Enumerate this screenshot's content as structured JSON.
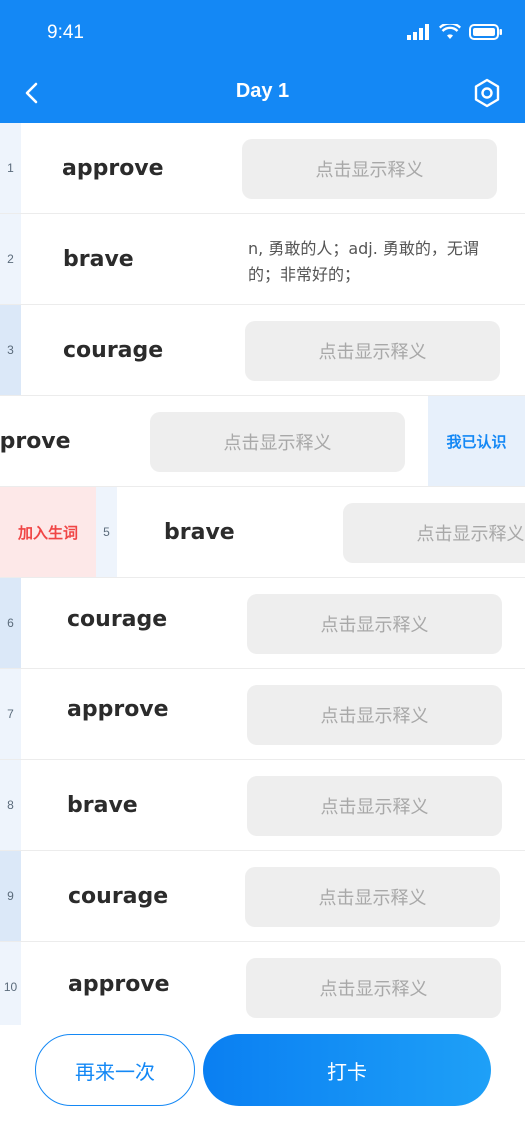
{
  "status_bar": {
    "time": "9:41"
  },
  "header": {
    "title": "Day 1",
    "back_icon": "chevron-left-icon",
    "settings_icon": "hexagon-gear-icon"
  },
  "colors": {
    "primary": "#1488f5",
    "danger": "#f04545"
  },
  "rows": [
    {
      "index": "1",
      "word": "approve",
      "meaning_button": "点击显示释义"
    },
    {
      "index": "2",
      "word": "brave",
      "meaning": "n, 勇敢的人；adj. 勇敢的，无谓的；非常好的；"
    },
    {
      "index": "3",
      "word": "courage",
      "meaning_button": "点击显示释义"
    },
    {
      "word": "approve",
      "meaning_button": "点击显示释义",
      "action": "我已认识"
    },
    {
      "index": "5",
      "word": "brave",
      "meaning_button": "点击显示释义",
      "action": "加入生词"
    },
    {
      "index": "6",
      "word": "courage",
      "meaning_button": "点击显示释义"
    },
    {
      "index": "7",
      "word": "approve",
      "meaning_button": "点击显示释义"
    },
    {
      "index": "8",
      "word": "brave",
      "meaning_button": "点击显示释义"
    },
    {
      "index": "9",
      "word": "courage",
      "meaning_button": "点击显示释义"
    },
    {
      "index": "10",
      "word": "approve",
      "meaning_button": "点击显示释义"
    }
  ],
  "footer": {
    "again_label": "再来一次",
    "checkin_label": "打卡"
  }
}
